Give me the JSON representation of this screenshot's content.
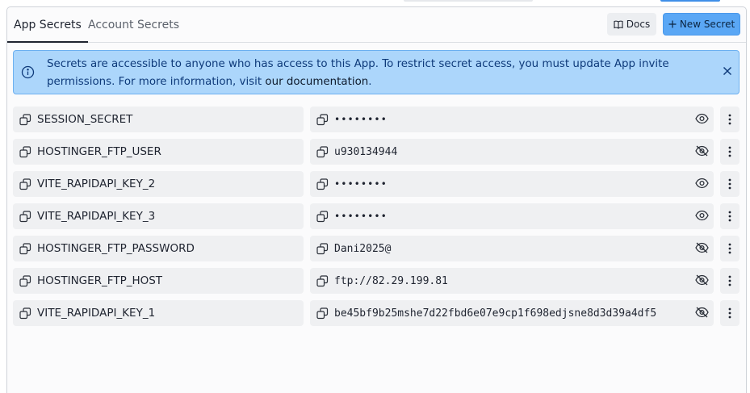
{
  "tabs": [
    {
      "label": "App Secrets",
      "active": true
    },
    {
      "label": "Account Secrets",
      "active": false
    }
  ],
  "toolbar": {
    "docs_label": "Docs",
    "new_secret_label": "New Secret"
  },
  "banner": {
    "text_part1": "Secrets are accessible to anyone who has access to this App. To restrict secret access, you must update App invite permissions. For more information, visit ",
    "link_text": "our documentation",
    "text_part2": ".",
    "icon": "info-icon"
  },
  "secrets": [
    {
      "key": "SESSION_SECRET",
      "value": "••••••••",
      "masked": true
    },
    {
      "key": "HOSTINGER_FTP_USER",
      "value": "u930134944",
      "masked": false
    },
    {
      "key": "VITE_RAPIDAPI_KEY_2",
      "value": "••••••••",
      "masked": true
    },
    {
      "key": "VITE_RAPIDAPI_KEY_3",
      "value": "••••••••",
      "masked": true
    },
    {
      "key": "HOSTINGER_FTP_PASSWORD",
      "value": "Dani2025@",
      "masked": false
    },
    {
      "key": "HOSTINGER_FTP_HOST",
      "value": "ftp://82.29.199.81",
      "masked": false
    },
    {
      "key": "VITE_RAPIDAPI_KEY_1",
      "value": "be45bf9b25mshe7d22fbd6e07e9cp1f698edjsne8d3d39a4df5",
      "masked": false
    }
  ],
  "colors": {
    "accent": "#5aa7f5",
    "banner_bg": "#acd6fb",
    "banner_border": "#6cb0f0",
    "cell_bg": "#eff0f2"
  }
}
